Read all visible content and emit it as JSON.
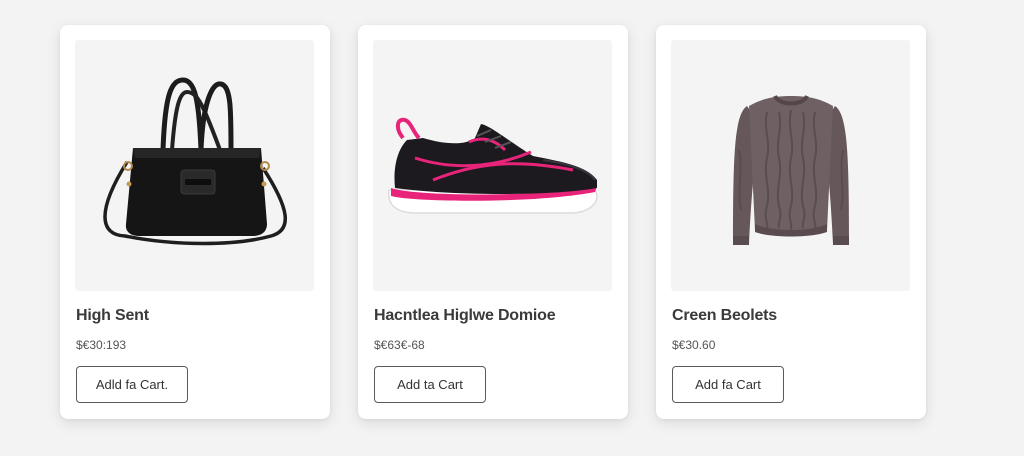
{
  "products": [
    {
      "title": "High Sent",
      "price": "$€30:193",
      "button_label": "Adld fa Cart.",
      "image_icon": "handbag-icon"
    },
    {
      "title": "Hacntlea Higlwe Domioe",
      "price": "$€63€-68",
      "button_label": "Add ta Cart",
      "image_icon": "sneaker-icon"
    },
    {
      "title": "Creen Beolets",
      "price": "$€30.60",
      "button_label": "Add fa Cart",
      "image_icon": "sweater-icon"
    }
  ],
  "colors": {
    "background": "#f3f3f3",
    "card": "#ffffff",
    "title_text": "#3a3a3a",
    "button_border": "#5a5a5a",
    "sneaker_accent": "#e8247a",
    "sweater": "#6e5f63"
  }
}
